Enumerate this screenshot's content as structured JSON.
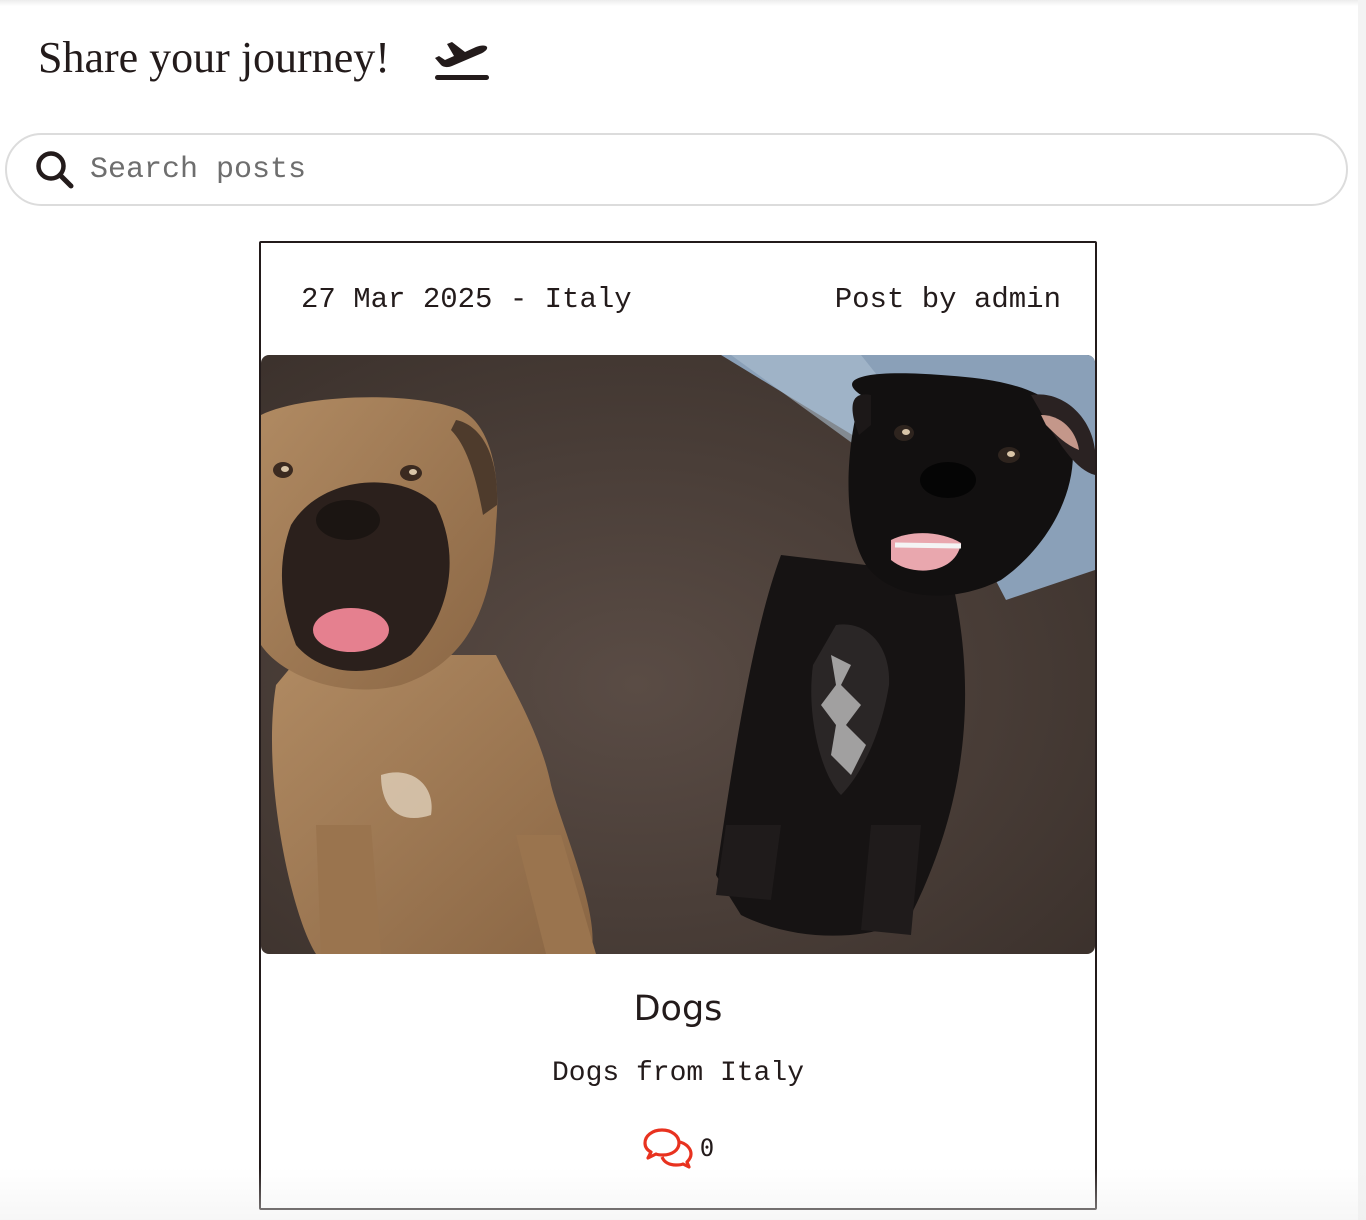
{
  "header": {
    "title": "Share your journey!",
    "icon": "airplane-departure-icon"
  },
  "search": {
    "placeholder": "Search posts",
    "value": "",
    "icon": "search-icon"
  },
  "post": {
    "meta_left": "27 Mar 2025 - Italy",
    "meta_right": "Post by admin",
    "image": "two-dogs-photo",
    "title": "Dogs",
    "subtitle": "Dogs from Italy",
    "comments_icon": "comments-icon",
    "comments_count": "0"
  },
  "colors": {
    "text": "#231b1b",
    "card_border": "#231b1b",
    "search_border": "#dcdcdc",
    "placeholder": "#6e6e6e",
    "comments_icon": "#e8321f"
  }
}
